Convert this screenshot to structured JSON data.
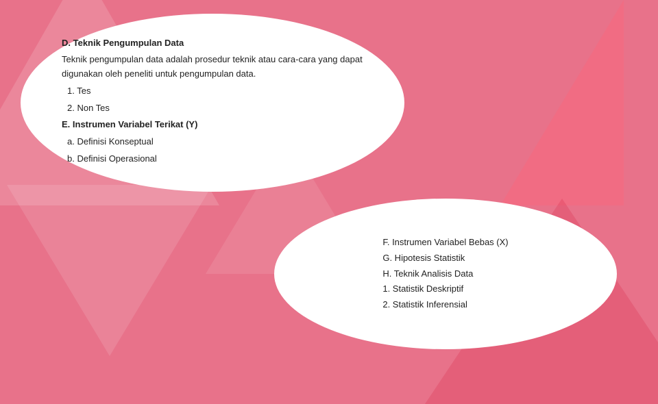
{
  "background": {
    "color": "#e8728a"
  },
  "top_card": {
    "section_d_title": "D. Teknik Pengumpulan Data",
    "section_d_body": "Teknik pengumpulan data adalah prosedur teknik atau cara-cara yang dapat digunakan oleh peneliti untuk pengumpulan data.",
    "list_1": "1.   Tes",
    "list_2": "2.   Non Tes",
    "section_e_title": "E. Instrumen Variabel Terikat (Y)",
    "item_a": "a.    Definisi Konseptual",
    "item_b": "b.    Definisi Operasional"
  },
  "bottom_card": {
    "line1": "F. Instrumen Variabel Bebas (X)",
    "line2": "G. Hipotesis Statistik",
    "line3": "H. Teknik Analisis Data",
    "line4": "1. Statistik Deskriptif",
    "line5": "2. Statistik Inferensial"
  }
}
